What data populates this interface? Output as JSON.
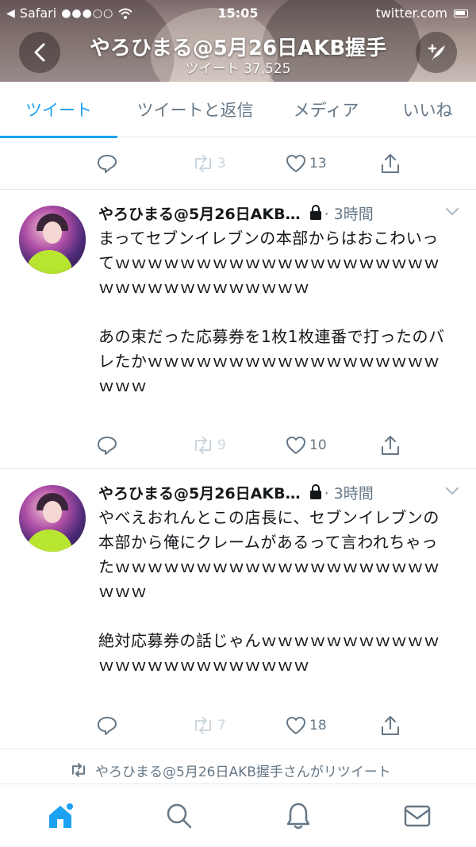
{
  "status_bar": {
    "app": "Safari",
    "time": "15:05",
    "url": "twitter.com"
  },
  "header": {
    "title": "やろひまる@5月26日AKB握手",
    "subtitle": "ツイート 37,525"
  },
  "tabs": [
    {
      "label": "ツイート",
      "active": true
    },
    {
      "label": "ツイートと返信",
      "active": false
    },
    {
      "label": "メディア",
      "active": false
    },
    {
      "label": "いいね",
      "active": false
    }
  ],
  "partial_tweet": {
    "retweets": "3",
    "likes": "13"
  },
  "tweets": [
    {
      "name": "やろひまる@5月26日AKB…",
      "time": "· 3時間",
      "text": "まってセブンイレブンの本部からはおこわいってｗｗｗｗｗｗｗｗｗｗｗｗｗｗｗｗｗｗｗｗｗｗｗｗｗｗｗｗｗｗｗｗｗ\n\nあの束だった応募券を1枚1枚連番で打ったのバレたかｗｗｗｗｗｗｗｗｗｗｗｗｗｗｗｗｗｗｗｗｗ",
      "retweets": "9",
      "likes": "10"
    },
    {
      "name": "やろひまる@5月26日AKB…",
      "time": "· 3時間",
      "text": "やべえおれんとこの店長に、セブンイレブンの本部から俺にクレームがあるって言われちゃったｗｗｗｗｗｗｗｗｗｗｗｗｗｗｗｗｗｗｗｗｗｗｗ\n\n絶対応募券の話じゃんｗｗｗｗｗｗｗｗｗｗｗｗｗｗｗｗｗｗｗｗｗｗｗｗ",
      "retweets": "7",
      "likes": "18"
    }
  ],
  "retweet_notice": "やろひまる@5月26日AKB握手さんがリツイート",
  "icons": [
    "back-icon",
    "compose-icon",
    "reply-icon",
    "retweet-icon",
    "like-icon",
    "share-icon",
    "lock-icon",
    "chevron-down-icon",
    "home-icon",
    "search-icon",
    "notifications-icon",
    "messages-icon"
  ],
  "colors": {
    "accent": "#1da1f2",
    "text": "#14171a",
    "muted": "#657786",
    "faded": "#ccd6dd"
  }
}
